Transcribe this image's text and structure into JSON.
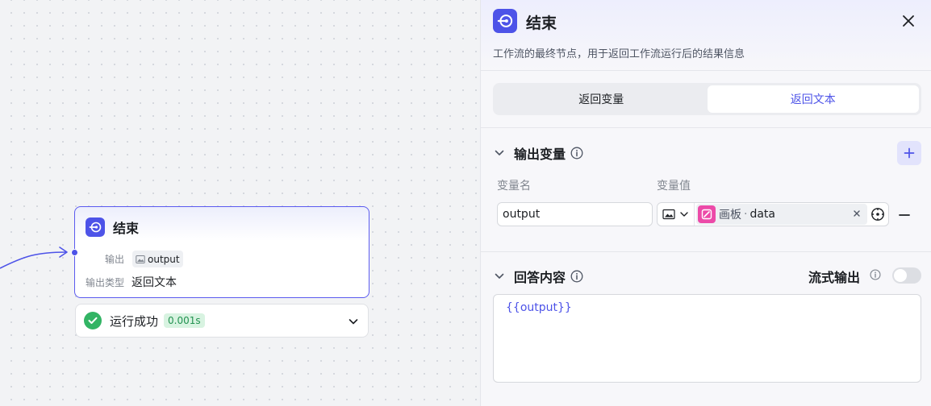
{
  "canvas": {
    "node": {
      "title": "结束",
      "output_label": "输出",
      "output_var": "output",
      "output_type_label": "输出类型",
      "output_type_value": "返回文本"
    },
    "run_status": {
      "label": "运行成功",
      "duration": "0.001s"
    }
  },
  "panel": {
    "title": "结束",
    "description": "工作流的最终节点，用于返回工作流运行后的结果信息",
    "tabs": [
      {
        "label": "返回变量",
        "active": false
      },
      {
        "label": "返回文本",
        "active": true
      }
    ],
    "output_section": {
      "title": "输出变量",
      "col_name": "变量名",
      "col_value": "变量值",
      "rows": [
        {
          "name": "output",
          "ref_node": "画板",
          "ref_separator": "·",
          "ref_var": "data"
        }
      ]
    },
    "answer_section": {
      "title": "回答内容",
      "stream_label": "流式输出",
      "stream_enabled": false,
      "content": "{{output}}"
    }
  },
  "colors": {
    "accent": "#4d53e8",
    "success": "#32b464",
    "chip_pink": "#ec4aa8"
  }
}
